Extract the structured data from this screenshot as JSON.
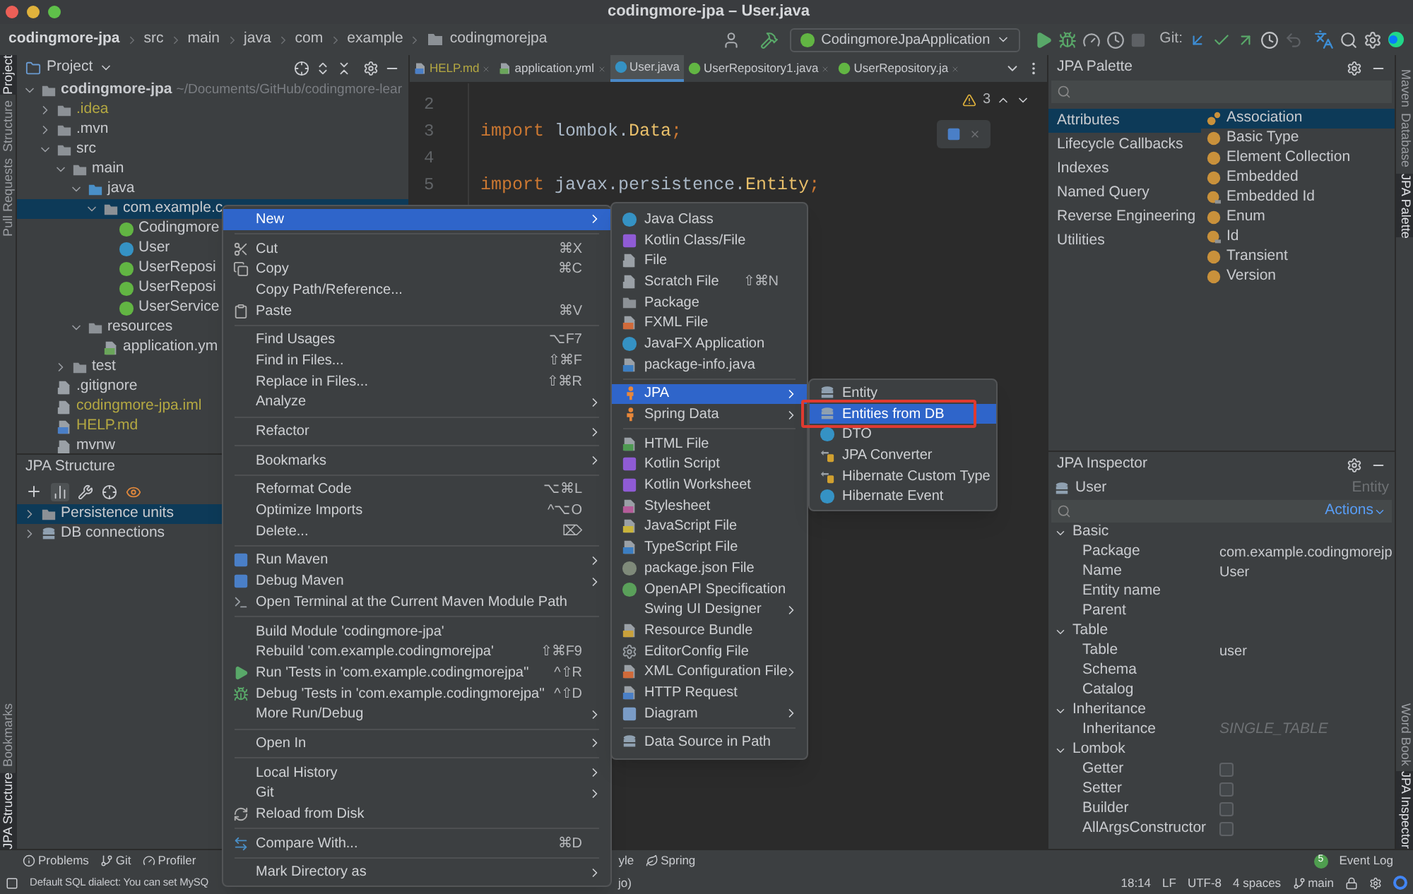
{
  "window": {
    "title": "codingmore-jpa – User.java"
  },
  "breadcrumbs": [
    "codingmore-jpa",
    "src",
    "main",
    "java",
    "com",
    "example",
    "codingmorejpa"
  ],
  "toolbar": {
    "run_config": "CodingmoreJpaApplication",
    "git_label": "Git:"
  },
  "left_strip_top": [
    {
      "label": "Project",
      "selected": true
    },
    {
      "label": "Structure",
      "selected": false
    },
    {
      "label": "Pull Requests",
      "selected": false
    }
  ],
  "left_strip_bottom": [
    {
      "label": "Bookmarks",
      "selected": false
    },
    {
      "label": "JPA Structure",
      "selected": true
    }
  ],
  "right_strip_top": [
    {
      "label": "Maven",
      "selected": false
    },
    {
      "label": "Database",
      "selected": false
    },
    {
      "label": "JPA Palette",
      "selected": true
    }
  ],
  "right_strip_bottom": [
    {
      "label": "Word Book",
      "selected": false
    },
    {
      "label": "JPA Inspector",
      "selected": true
    }
  ],
  "project": {
    "title": "Project",
    "tree": [
      {
        "label": "codingmore-jpa",
        "note": "~/Documents/GitHub/codingmore-lear",
        "kind": "module",
        "expanded": true,
        "selected": false,
        "ignored": false,
        "children": [
          {
            "label": ".idea",
            "kind": "folder",
            "expanded": false,
            "selected": false,
            "ignored": true
          },
          {
            "label": ".mvn",
            "kind": "folder",
            "expanded": false,
            "selected": false,
            "ignored": false
          },
          {
            "label": "src",
            "kind": "folder",
            "expanded": true,
            "selected": false,
            "ignored": false,
            "children": [
              {
                "label": "main",
                "kind": "folder",
                "expanded": true,
                "selected": false,
                "ignored": false,
                "children": [
                  {
                    "label": "java",
                    "kind": "source",
                    "expanded": true,
                    "selected": false,
                    "ignored": false,
                    "children": [
                      {
                        "label": "com.example.c",
                        "kind": "package",
                        "expanded": true,
                        "selected": true,
                        "ignored": false,
                        "children": [
                          {
                            "label": "Codingmore",
                            "kind": "spring",
                            "selected": false,
                            "ignored": false
                          },
                          {
                            "label": "User",
                            "kind": "class",
                            "selected": false,
                            "ignored": false
                          },
                          {
                            "label": "UserReposi",
                            "kind": "interface",
                            "selected": false,
                            "ignored": false
                          },
                          {
                            "label": "UserReposi",
                            "kind": "interface",
                            "selected": false,
                            "ignored": false
                          },
                          {
                            "label": "UserService",
                            "kind": "interface",
                            "selected": false,
                            "ignored": false
                          }
                        ]
                      }
                    ]
                  },
                  {
                    "label": "resources",
                    "kind": "resources",
                    "expanded": true,
                    "selected": false,
                    "ignored": false,
                    "children": [
                      {
                        "label": "application.ym",
                        "kind": "yaml",
                        "selected": false,
                        "ignored": false
                      }
                    ]
                  }
                ]
              },
              {
                "label": "test",
                "kind": "folder",
                "expanded": false,
                "selected": false,
                "ignored": false
              }
            ]
          },
          {
            "label": ".gitignore",
            "kind": "file",
            "selected": false,
            "ignored": false
          },
          {
            "label": "codingmore-jpa.iml",
            "kind": "file",
            "selected": false,
            "ignored": true
          },
          {
            "label": "HELP.md",
            "kind": "markdown",
            "selected": false,
            "ignored": true
          },
          {
            "label": "mvnw",
            "kind": "file",
            "selected": false,
            "ignored": false
          }
        ]
      }
    ]
  },
  "jpa_structure": {
    "title": "JPA Structure",
    "tree": [
      {
        "label": "Persistence units",
        "kind": "units",
        "expanded": false,
        "selected": true
      },
      {
        "label": "DB connections",
        "kind": "db",
        "expanded": false,
        "selected": false
      }
    ]
  },
  "editor": {
    "tabs": [
      {
        "label": "HELP.md",
        "kind": "markdown",
        "selected": false,
        "ignored": true
      },
      {
        "label": "application.yml",
        "kind": "yaml",
        "selected": false,
        "ignored": false
      },
      {
        "label": "User.java",
        "kind": "class",
        "selected": true,
        "ignored": false
      },
      {
        "label": "UserRepository1.java",
        "kind": "interface",
        "selected": false,
        "ignored": false
      },
      {
        "label": "UserRepository.ja",
        "kind": "interface",
        "selected": false,
        "ignored": false
      }
    ],
    "warnings": "3",
    "lines": [
      {
        "number": "2"
      },
      {
        "number": "3",
        "tokens": [
          {
            "kind": "keyword",
            "text": "import "
          },
          {
            "kind": "plain",
            "text": "lombok."
          },
          {
            "kind": "type",
            "text": "Data"
          },
          {
            "kind": "keyword",
            "text": ";"
          }
        ]
      },
      {
        "number": "4"
      },
      {
        "number": "5",
        "tokens": [
          {
            "kind": "keyword",
            "text": "import "
          },
          {
            "kind": "plain",
            "text": "javax.persistence."
          },
          {
            "kind": "type",
            "text": "Entity"
          },
          {
            "kind": "keyword",
            "text": ";"
          }
        ]
      }
    ]
  },
  "context_menu": [
    {
      "kind": "plain",
      "label": "New",
      "submenu": true,
      "selected": true
    },
    {
      "kind": "separator"
    },
    {
      "kind": "cut",
      "label": "Cut",
      "shortcut": "⌘X",
      "submenu": false,
      "selected": false
    },
    {
      "kind": "copy",
      "label": "Copy",
      "shortcut": "⌘C",
      "submenu": false,
      "selected": false
    },
    {
      "kind": "plain",
      "label": "Copy Path/Reference...",
      "submenu": false,
      "selected": false
    },
    {
      "kind": "paste",
      "label": "Paste",
      "shortcut": "⌘V",
      "submenu": false,
      "selected": false
    },
    {
      "kind": "separator"
    },
    {
      "kind": "plain",
      "label": "Find Usages",
      "shortcut": "⌥F7",
      "submenu": false,
      "selected": false
    },
    {
      "kind": "plain",
      "label": "Find in Files...",
      "shortcut": "⇧⌘F",
      "submenu": false,
      "selected": false
    },
    {
      "kind": "plain",
      "label": "Replace in Files...",
      "shortcut": "⇧⌘R",
      "submenu": false,
      "selected": false
    },
    {
      "kind": "plain",
      "label": "Analyze",
      "submenu": true,
      "selected": false
    },
    {
      "kind": "separator"
    },
    {
      "kind": "plain",
      "label": "Refactor",
      "submenu": true,
      "selected": false
    },
    {
      "kind": "separator"
    },
    {
      "kind": "plain",
      "label": "Bookmarks",
      "submenu": true,
      "selected": false
    },
    {
      "kind": "separator"
    },
    {
      "kind": "plain",
      "label": "Reformat Code",
      "shortcut": "⌥⌘L",
      "submenu": false,
      "selected": false
    },
    {
      "kind": "plain",
      "label": "Optimize Imports",
      "shortcut": "^⌥O",
      "submenu": false,
      "selected": false
    },
    {
      "kind": "plain",
      "label": "Delete...",
      "shortcut": "⌦",
      "submenu": false,
      "selected": false
    },
    {
      "kind": "separator"
    },
    {
      "kind": "maven",
      "label": "Run Maven",
      "submenu": true,
      "selected": false
    },
    {
      "kind": "maven",
      "label": "Debug Maven",
      "submenu": true,
      "selected": false
    },
    {
      "kind": "terminal",
      "label": "Open Terminal at the Current Maven Module Path",
      "submenu": false,
      "selected": false
    },
    {
      "kind": "separator"
    },
    {
      "kind": "plain",
      "label": "Build Module 'codingmore-jpa'",
      "submenu": false,
      "selected": false
    },
    {
      "kind": "plain",
      "label": "Rebuild 'com.example.codingmorejpa'",
      "shortcut": "⇧⌘F9",
      "submenu": false,
      "selected": false
    },
    {
      "kind": "run",
      "label": "Run 'Tests in 'com.example.codingmorejpa''",
      "shortcut": "^⇧R",
      "submenu": false,
      "selected": false
    },
    {
      "kind": "debug",
      "label": "Debug 'Tests in 'com.example.codingmorejpa''",
      "shortcut": "^⇧D",
      "submenu": false,
      "selected": false
    },
    {
      "kind": "plain",
      "label": "More Run/Debug",
      "submenu": true,
      "selected": false
    },
    {
      "kind": "separator"
    },
    {
      "kind": "plain",
      "label": "Open In",
      "submenu": true,
      "selected": false
    },
    {
      "kind": "separator"
    },
    {
      "kind": "plain",
      "label": "Local History",
      "submenu": true,
      "selected": false
    },
    {
      "kind": "plain",
      "label": "Git",
      "submenu": true,
      "selected": false
    },
    {
      "kind": "reload",
      "label": "Reload from Disk",
      "submenu": false,
      "selected": false
    },
    {
      "kind": "separator"
    },
    {
      "kind": "compare",
      "label": "Compare With...",
      "shortcut": "⌘D",
      "submenu": false,
      "selected": false
    },
    {
      "kind": "separator"
    },
    {
      "kind": "plain",
      "label": "Mark Directory as",
      "submenu": true,
      "selected": false
    }
  ],
  "new_menu": [
    {
      "kind": "class",
      "label": "Java Class",
      "submenu": false,
      "selected": false
    },
    {
      "kind": "kotlin",
      "label": "Kotlin Class/File",
      "submenu": false,
      "selected": false
    },
    {
      "kind": "file",
      "label": "File",
      "submenu": false,
      "selected": false
    },
    {
      "kind": "file",
      "label": "Scratch File",
      "shortcut": "⇧⌘N",
      "submenu": false,
      "selected": false
    },
    {
      "kind": "folder",
      "label": "Package",
      "submenu": false,
      "selected": false
    },
    {
      "kind": "fxml",
      "label": "FXML File",
      "submenu": false,
      "selected": false
    },
    {
      "kind": "class",
      "label": "JavaFX Application",
      "submenu": false,
      "selected": false
    },
    {
      "kind": "ts",
      "label": "package-info.java",
      "submenu": false,
      "selected": false
    },
    {
      "kind": "separator"
    },
    {
      "kind": "jpa",
      "label": "JPA",
      "submenu": true,
      "selected": true
    },
    {
      "kind": "jpa",
      "label": "Spring Data",
      "submenu": true,
      "selected": false
    },
    {
      "kind": "separator"
    },
    {
      "kind": "html",
      "label": "HTML File",
      "submenu": false,
      "selected": false
    },
    {
      "kind": "kotlin",
      "label": "Kotlin Script",
      "submenu": false,
      "selected": false
    },
    {
      "kind": "kotlin",
      "label": "Kotlin Worksheet",
      "submenu": false,
      "selected": false
    },
    {
      "kind": "css",
      "label": "Stylesheet",
      "submenu": false,
      "selected": false
    },
    {
      "kind": "js",
      "label": "JavaScript File",
      "submenu": false,
      "selected": false
    },
    {
      "kind": "ts",
      "label": "TypeScript File",
      "submenu": false,
      "selected": false
    },
    {
      "kind": "json",
      "label": "package.json File",
      "submenu": false,
      "selected": false
    },
    {
      "kind": "openapi",
      "label": "OpenAPI Specification",
      "submenu": false,
      "selected": false
    },
    {
      "kind": "plain",
      "label": "Swing UI Designer",
      "submenu": true,
      "selected": false
    },
    {
      "kind": "bundle",
      "label": "Resource Bundle",
      "submenu": false,
      "selected": false
    },
    {
      "kind": "gear",
      "label": "EditorConfig File",
      "submenu": false,
      "selected": false
    },
    {
      "kind": "fxml",
      "label": "XML Configuration File",
      "submenu": true,
      "selected": false
    },
    {
      "kind": "http",
      "label": "HTTP Request",
      "submenu": false,
      "selected": false
    },
    {
      "kind": "diagram",
      "label": "Diagram",
      "submenu": true,
      "selected": false
    },
    {
      "kind": "separator"
    },
    {
      "kind": "db",
      "label": "Data Source in Path",
      "submenu": false,
      "selected": false
    }
  ],
  "jpa_menu": [
    {
      "kind": "db",
      "label": "Entity",
      "submenu": false,
      "selected": false,
      "outlined": false
    },
    {
      "kind": "db",
      "label": "Entities from DB",
      "submenu": false,
      "selected": true,
      "outlined": true
    },
    {
      "kind": "class",
      "label": "DTO",
      "submenu": false,
      "selected": false,
      "outlined": false
    },
    {
      "kind": "converter",
      "label": "JPA Converter",
      "submenu": false,
      "selected": false,
      "outlined": false
    },
    {
      "kind": "converter",
      "label": "Hibernate Custom Type",
      "submenu": false,
      "selected": false,
      "outlined": false
    },
    {
      "kind": "class",
      "label": "Hibernate Event",
      "submenu": false,
      "selected": false,
      "outlined": false
    }
  ],
  "palette": {
    "title": "JPA Palette",
    "categories": [
      {
        "label": "Attributes",
        "selected": true
      },
      {
        "label": "Lifecycle Callbacks",
        "selected": false
      },
      {
        "label": "Indexes",
        "selected": false
      },
      {
        "label": "Named Query",
        "selected": false
      },
      {
        "label": "Reverse Engineering",
        "selected": false
      },
      {
        "label": "Utilities",
        "selected": false
      }
    ],
    "items": [
      {
        "label": "Association",
        "kind": "association",
        "selected": true
      },
      {
        "label": "Basic Type",
        "kind": "annotation",
        "selected": false
      },
      {
        "label": "Element Collection",
        "kind": "annotation",
        "selected": false
      },
      {
        "label": "Embedded",
        "kind": "annotation",
        "selected": false
      },
      {
        "label": "Embedded Id",
        "kind": "key",
        "selected": false
      },
      {
        "label": "Enum",
        "kind": "annotation",
        "selected": false
      },
      {
        "label": "Id",
        "kind": "key",
        "selected": false
      },
      {
        "label": "Transient",
        "kind": "annotation",
        "selected": false
      },
      {
        "label": "Version",
        "kind": "annotation",
        "selected": false
      }
    ]
  },
  "inspector": {
    "title": "JPA Inspector",
    "entity": "User",
    "entity_type": "Entity",
    "actions": "Actions",
    "groups": [
      {
        "label": "Basic",
        "expanded": true,
        "properties": [
          {
            "name": "Package",
            "kind": "text",
            "value": "com.example.codingmorejp"
          },
          {
            "name": "Name",
            "kind": "text",
            "value": "User"
          },
          {
            "name": "Entity name",
            "kind": "text"
          },
          {
            "name": "Parent",
            "kind": "text"
          }
        ]
      },
      {
        "label": "Table",
        "expanded": true,
        "properties": [
          {
            "name": "Table",
            "kind": "text",
            "value": "user"
          },
          {
            "name": "Schema",
            "kind": "text"
          },
          {
            "name": "Catalog",
            "kind": "text"
          }
        ]
      },
      {
        "label": "Inheritance",
        "expanded": true,
        "properties": [
          {
            "name": "Inheritance",
            "kind": "default",
            "value": "SINGLE_TABLE"
          }
        ]
      },
      {
        "label": "Lombok",
        "expanded": true,
        "properties": [
          {
            "name": "Getter",
            "kind": "checkbox",
            "checked": false
          },
          {
            "name": "Setter",
            "kind": "checkbox",
            "checked": false
          },
          {
            "name": "Builder",
            "kind": "checkbox",
            "checked": false
          },
          {
            "name": "AllArgsConstructor",
            "kind": "checkbox",
            "checked": false
          }
        ]
      }
    ]
  },
  "tool_windows": [
    {
      "label": "Problems",
      "kind": "problems"
    },
    {
      "label": "Git",
      "kind": "git"
    },
    {
      "label": "Profiler",
      "kind": "profiler"
    }
  ],
  "tool_windows_right": [
    {
      "label": "yle",
      "kind": "plain"
    },
    {
      "label": "Spring",
      "kind": "spring"
    }
  ],
  "event_log": {
    "label": "Event Log",
    "count": "5"
  },
  "status_bar": {
    "message": "Default SQL dialect: You can set MySQ",
    "fragment": "jo)",
    "items": [
      "18:14",
      "LF",
      "UTF-8",
      "4 spaces"
    ],
    "branch": "main"
  }
}
